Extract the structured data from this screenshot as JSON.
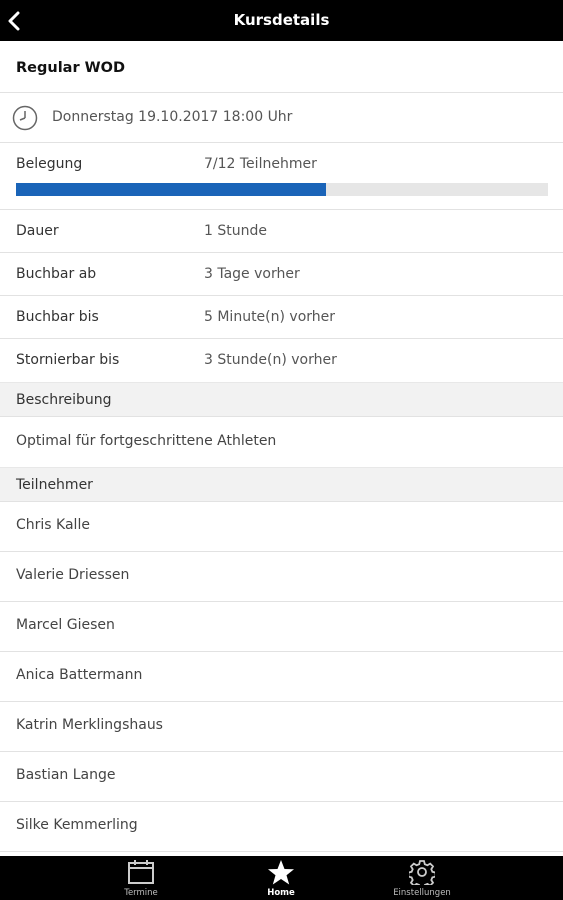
{
  "header": {
    "title": "Kursdetails",
    "back_icon": "chevron-left-icon"
  },
  "course": {
    "name": "Regular WOD",
    "datetime": "Donnerstag 19.10.2017 18:00 Uhr",
    "clock_icon": "clock-icon"
  },
  "occupancy": {
    "label": "Belegung",
    "value": "7/12 Teilnehmer",
    "booked": 7,
    "capacity": 12,
    "fill_color": "#1a64b8"
  },
  "details": [
    {
      "label": "Dauer",
      "value": "1 Stunde"
    },
    {
      "label": "Buchbar ab",
      "value": "3 Tage vorher"
    },
    {
      "label": "Buchbar bis",
      "value": "5 Minute(n) vorher"
    },
    {
      "label": "Stornierbar bis",
      "value": "3 Stunde(n) vorher"
    }
  ],
  "description": {
    "header": "Beschreibung",
    "text": "Optimal für fortgeschrittene Athleten"
  },
  "participants": {
    "header": "Teilnehmer",
    "names": [
      "Chris Kalle",
      "Valerie Driessen",
      "Marcel Giesen",
      "Anica Battermann",
      "Katrin Merklingshaus",
      "Bastian Lange",
      "Silke Kemmerling"
    ]
  },
  "tabs": [
    {
      "label": "Termine",
      "icon": "calendar-icon",
      "active": false
    },
    {
      "label": "Home",
      "icon": "star-icon",
      "active": true
    },
    {
      "label": "Einstellungen",
      "icon": "gear-icon",
      "active": false
    }
  ]
}
